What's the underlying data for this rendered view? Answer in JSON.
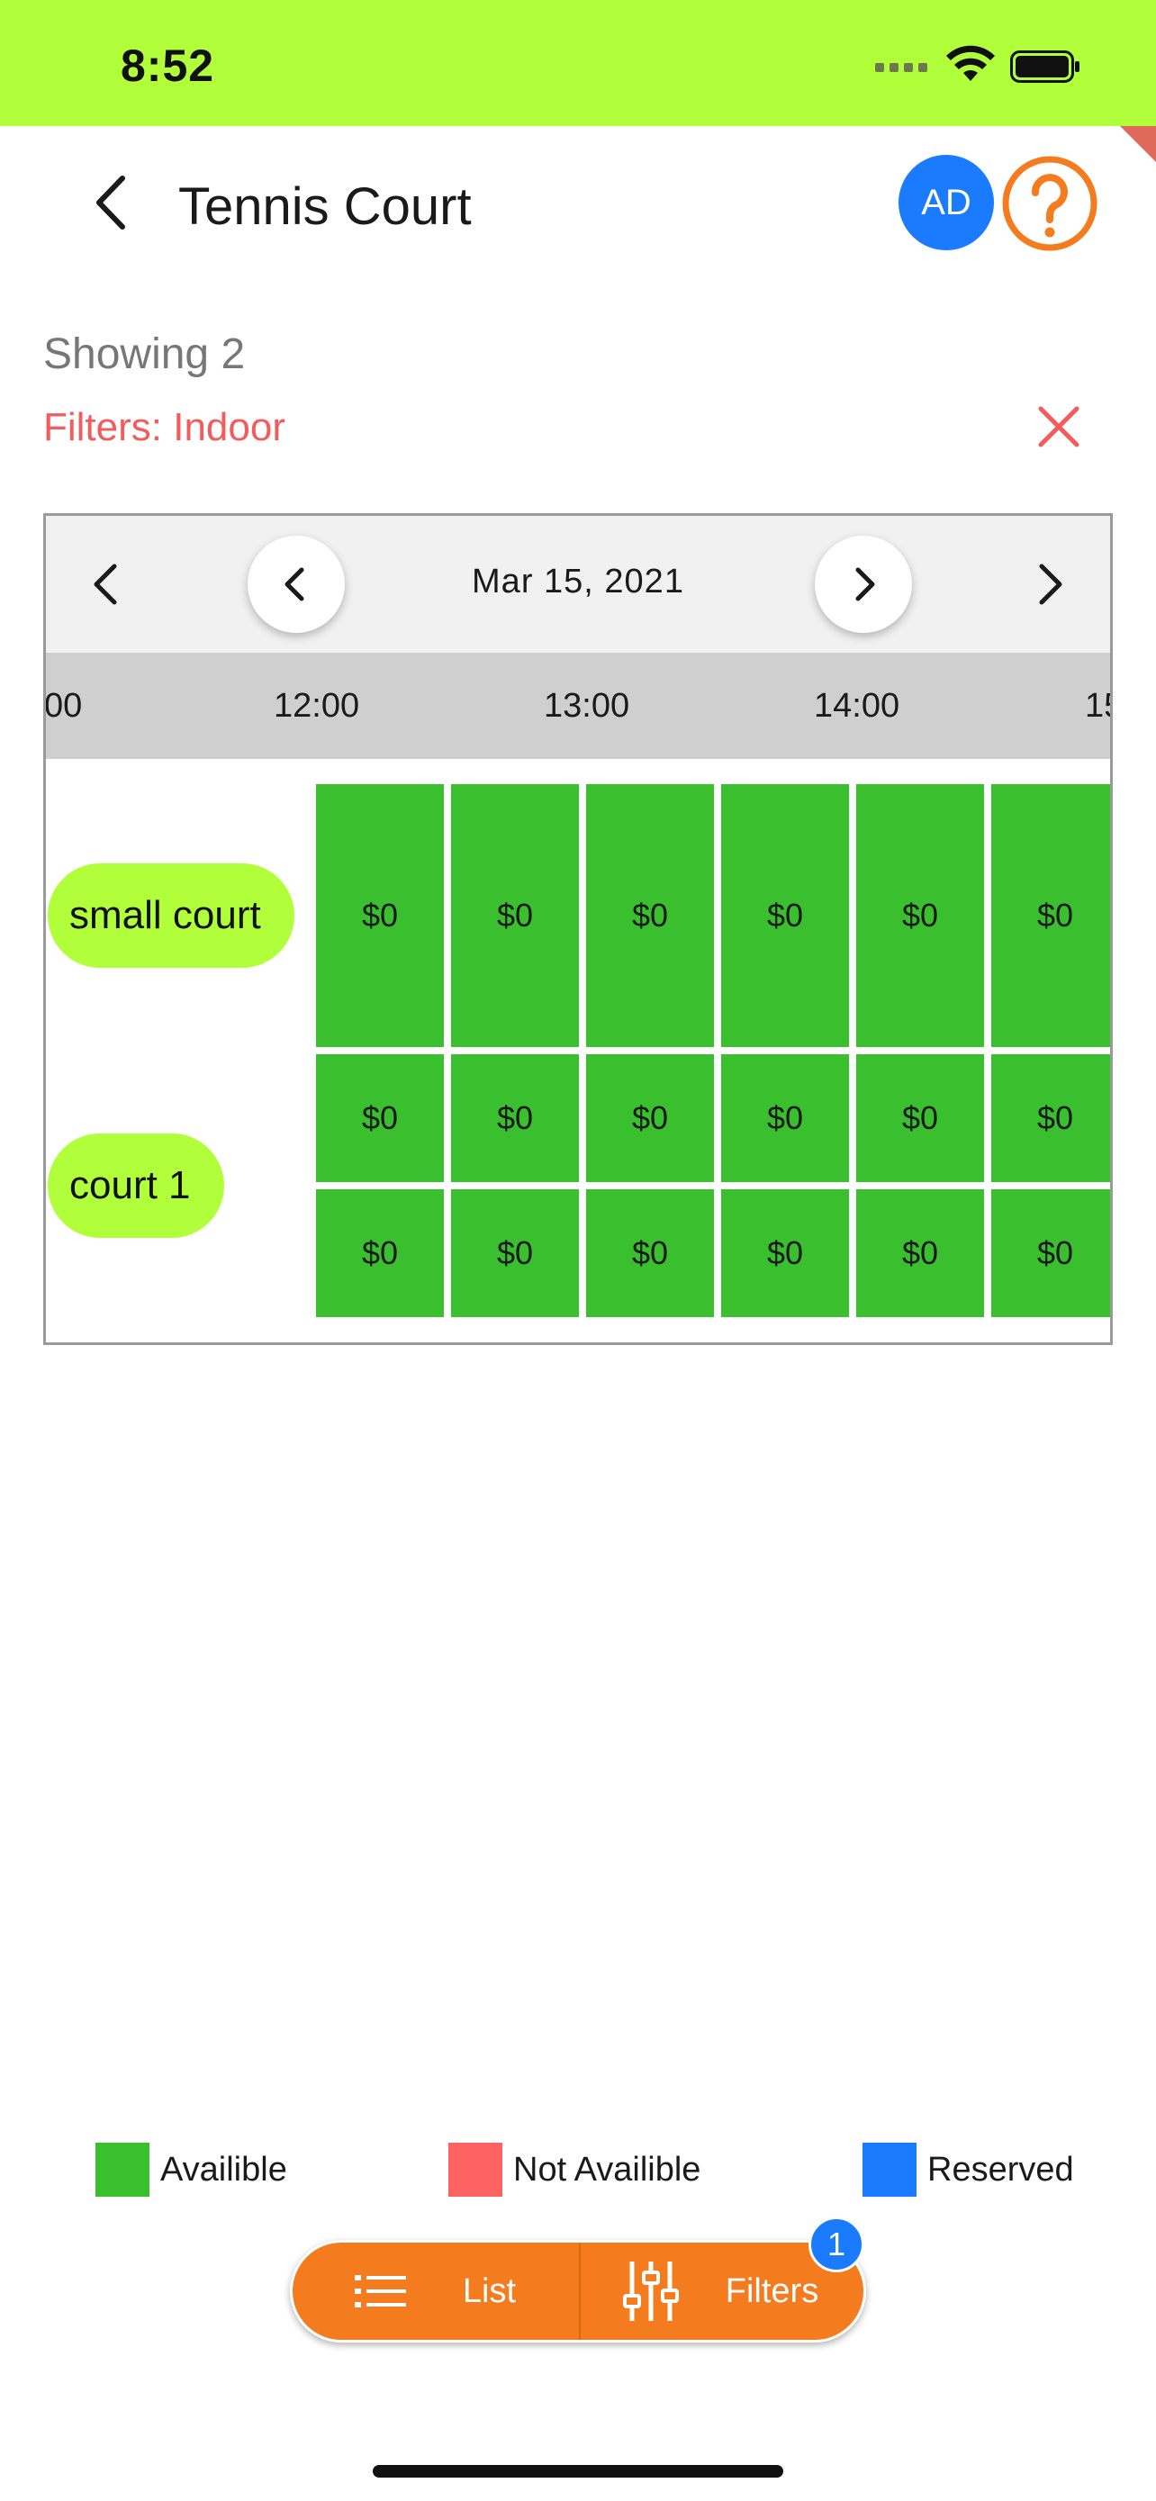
{
  "status_bar": {
    "time": "8:52"
  },
  "header": {
    "title": "Tennis Court",
    "avatar_initials": "AD",
    "accent_color": "#b1ff3a",
    "avatar_color": "#1a7bff",
    "help_color": "#f47b1e"
  },
  "results": {
    "showing": "Showing 2",
    "filters": "Filters: Indoor"
  },
  "scheduler": {
    "date": "Mar 15, 2021",
    "times": [
      "00",
      "12:00",
      "13:00",
      "14:00",
      "15"
    ],
    "courts": [
      {
        "name": "small court",
        "rows": [
          [
            "$0",
            "$0",
            "$0",
            "$0",
            "$0",
            "$0"
          ]
        ]
      },
      {
        "name": "court 1",
        "rows": [
          [
            "$0",
            "$0",
            "$0",
            "$0",
            "$0",
            "$0"
          ],
          [
            "$0",
            "$0",
            "$0",
            "$0",
            "$0",
            "$0"
          ]
        ]
      }
    ],
    "available_color": "#3abf2e"
  },
  "legend": [
    {
      "label": "Availible",
      "color": "#3abf2e"
    },
    {
      "label": "Not Availible",
      "color": "#ff6262"
    },
    {
      "label": "Reserved",
      "color": "#1a7bff"
    }
  ],
  "bottom_bar": {
    "list_label": "List",
    "filters_label": "Filters",
    "filters_count": "1",
    "color": "#f47b1e"
  }
}
